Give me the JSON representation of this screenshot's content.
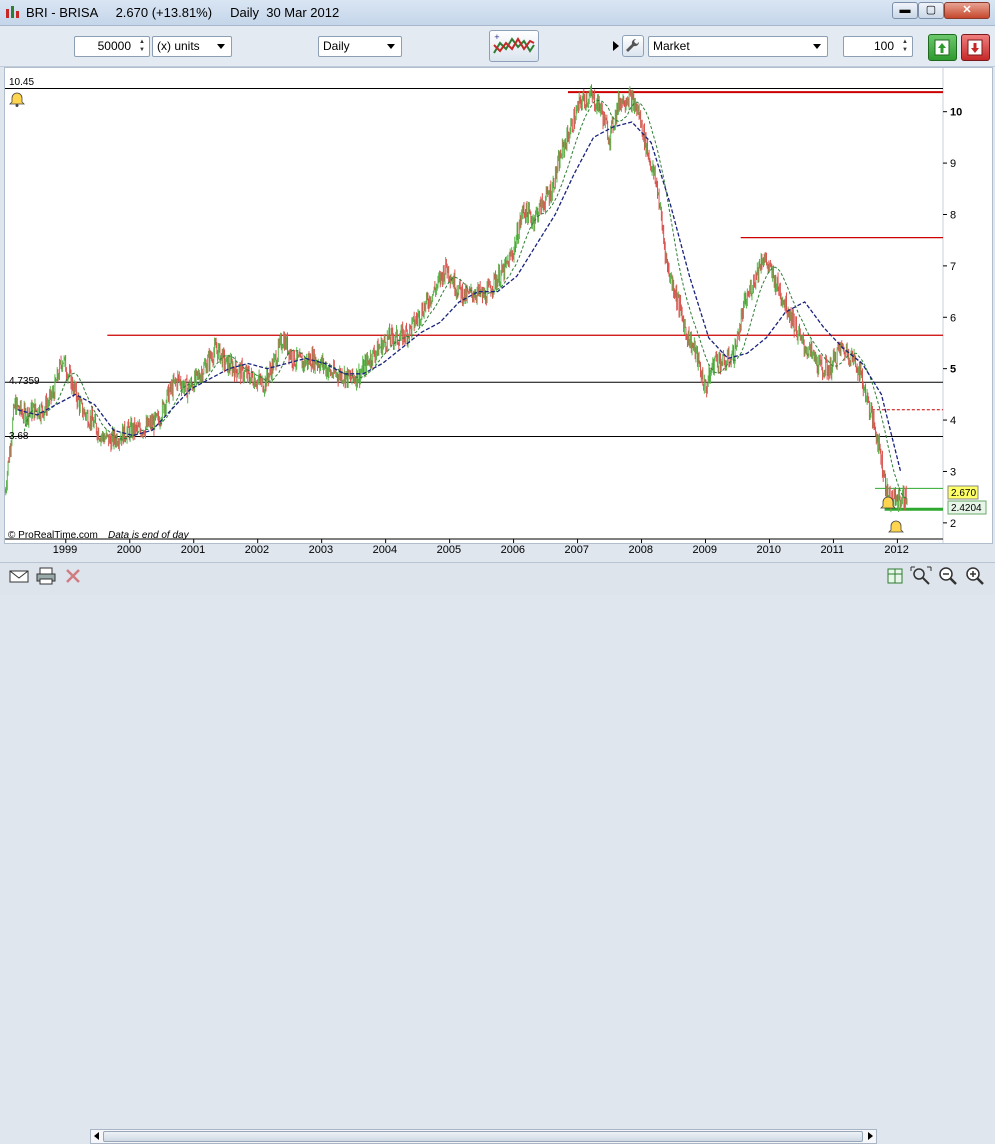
{
  "window": {
    "title": "BRI - BRISA     2.670 (+13.81%)     Daily  30 Mar 2012",
    "min_glyph": "▬",
    "max_glyph": "▢",
    "close_glyph": "✕"
  },
  "toolbar": {
    "quantity": "50000",
    "units": "(x) units",
    "period": "Daily",
    "order_type": "Market",
    "order_quantity": "100"
  },
  "chart": {
    "credit": "© ProRealTime.com",
    "credit_note": "Data is end of day",
    "current_price_label": "2.670",
    "second_price_label": "2.4204",
    "level_labels": [
      "10.45",
      "4.7359",
      "3.68"
    ],
    "accent_colors": {
      "up": "#5ab34a",
      "down": "#d9534f",
      "ma_short": "#2e7d32",
      "ma_long": "#1a237e",
      "support_red": "#cc0000",
      "current": "#ffff66"
    }
  },
  "icons": [
    "alarm-bell-icon",
    "indicator-chart-icon",
    "wrench-icon",
    "buy-icon",
    "sell-icon",
    "email-icon",
    "print-icon",
    "delete-icon",
    "table-icon",
    "zoom-fit-icon",
    "zoom-out-icon",
    "zoom-in-icon"
  ],
  "chart_data": {
    "type": "line",
    "title": "BRI - BRISA",
    "y_axis_ticks": [
      "2",
      "3",
      "4",
      "5",
      "6",
      "7",
      "8",
      "9",
      "10"
    ],
    "x_axis_ticks": [
      "1999",
      "2000",
      "2001",
      "2002",
      "2003",
      "2004",
      "2005",
      "2006",
      "2007",
      "2008",
      "2009",
      "2010",
      "2011",
      "2012"
    ],
    "ylim": [
      1.9,
      10.85
    ],
    "xlim": [
      1998.1,
      2012.7
    ],
    "grid": false,
    "series": [
      {
        "type": "price",
        "x": [
          1998.1,
          1998.25,
          1998.4,
          1998.55,
          1998.7,
          1998.85,
          1999.0,
          1999.15,
          1999.3,
          1999.45,
          1999.6,
          1999.75,
          1999.9,
          2000.05,
          2000.2,
          2000.35,
          2000.5,
          2000.65,
          2000.8,
          2000.95,
          2001.1,
          2001.25,
          2001.4,
          2001.55,
          2001.7,
          2001.85,
          2002.0,
          2002.15,
          2002.3,
          2002.45,
          2002.6,
          2002.75,
          2002.9,
          2003.05,
          2003.2,
          2003.35,
          2003.5,
          2003.65,
          2003.8,
          2003.95,
          2004.1,
          2004.25,
          2004.4,
          2004.55,
          2004.7,
          2004.85,
          2005.0,
          2005.15,
          2005.3,
          2005.45,
          2005.6,
          2005.75,
          2005.9,
          2006.05,
          2006.2,
          2006.35,
          2006.5,
          2006.65,
          2006.8,
          2006.95,
          2007.1,
          2007.25,
          2007.4,
          2007.55,
          2007.7,
          2007.85,
          2008.0,
          2008.15,
          2008.3,
          2008.45,
          2008.6,
          2008.75,
          2008.9,
          2009.05,
          2009.2,
          2009.35,
          2009.5,
          2009.65,
          2009.8,
          2009.95,
          2010.1,
          2010.25,
          2010.4,
          2010.55,
          2010.7,
          2010.85,
          2011.0,
          2011.15,
          2011.3,
          2011.45,
          2011.6,
          2011.75,
          2011.9,
          2012.05,
          2012.2
        ],
        "y": [
          2.6,
          4.3,
          4.1,
          4.2,
          4.2,
          4.5,
          5.2,
          4.7,
          4.2,
          4.0,
          3.7,
          3.6,
          3.7,
          3.8,
          3.8,
          3.9,
          4.0,
          4.5,
          4.8,
          4.6,
          4.8,
          5.1,
          5.4,
          5.1,
          5.0,
          4.9,
          4.8,
          4.7,
          5.1,
          5.6,
          5.2,
          5.1,
          5.2,
          5.1,
          4.9,
          4.9,
          4.8,
          4.9,
          5.2,
          5.4,
          5.6,
          5.6,
          5.7,
          6.0,
          6.3,
          6.6,
          7.0,
          6.6,
          6.4,
          6.5,
          6.4,
          6.7,
          6.9,
          7.3,
          8.1,
          7.9,
          8.2,
          8.5,
          9.2,
          9.7,
          10.2,
          10.3,
          10.1,
          9.5,
          10.2,
          10.3,
          10.0,
          9.2,
          8.5,
          7.0,
          6.4,
          5.7,
          5.3,
          4.6,
          5.2,
          5.1,
          5.3,
          6.2,
          6.7,
          7.2,
          6.8,
          6.4,
          6.0,
          5.5,
          5.3,
          5.0,
          5.0,
          5.4,
          5.3,
          5.0,
          4.3,
          3.6,
          2.5,
          2.45,
          2.5
        ]
      },
      {
        "type": "moving_average_long",
        "x": [
          1998.3,
          1998.6,
          1998.9,
          1999.2,
          1999.5,
          1999.8,
          2000.1,
          2000.4,
          2000.7,
          2001.0,
          2001.3,
          2001.6,
          2001.9,
          2002.2,
          2002.5,
          2002.8,
          2003.1,
          2003.4,
          2003.7,
          2004.0,
          2004.3,
          2004.6,
          2004.9,
          2005.2,
          2005.5,
          2005.8,
          2006.1,
          2006.4,
          2006.7,
          2007.0,
          2007.3,
          2007.6,
          2007.9,
          2008.2,
          2008.5,
          2008.8,
          2009.1,
          2009.4,
          2009.7,
          2010.0,
          2010.3,
          2010.6,
          2010.9,
          2011.2,
          2011.5,
          2011.8,
          2012.1
        ],
        "y": [
          4.2,
          4.1,
          4.3,
          4.5,
          4.3,
          3.8,
          3.7,
          3.8,
          4.2,
          4.6,
          4.8,
          5.0,
          5.1,
          5.0,
          5.1,
          5.2,
          5.1,
          4.9,
          4.9,
          5.1,
          5.4,
          5.7,
          5.9,
          6.3,
          6.5,
          6.5,
          6.8,
          7.4,
          8.0,
          8.8,
          9.5,
          9.7,
          9.8,
          9.4,
          8.2,
          6.8,
          5.6,
          5.2,
          5.3,
          5.6,
          6.1,
          6.3,
          5.8,
          5.4,
          5.1,
          4.5,
          3.0
        ]
      }
    ],
    "horizontal_levels": [
      10.45,
      10.38,
      7.55,
      5.65,
      4.7359,
      4.2,
      3.68
    ],
    "current_price": 2.67,
    "last_support": 2.4204
  }
}
